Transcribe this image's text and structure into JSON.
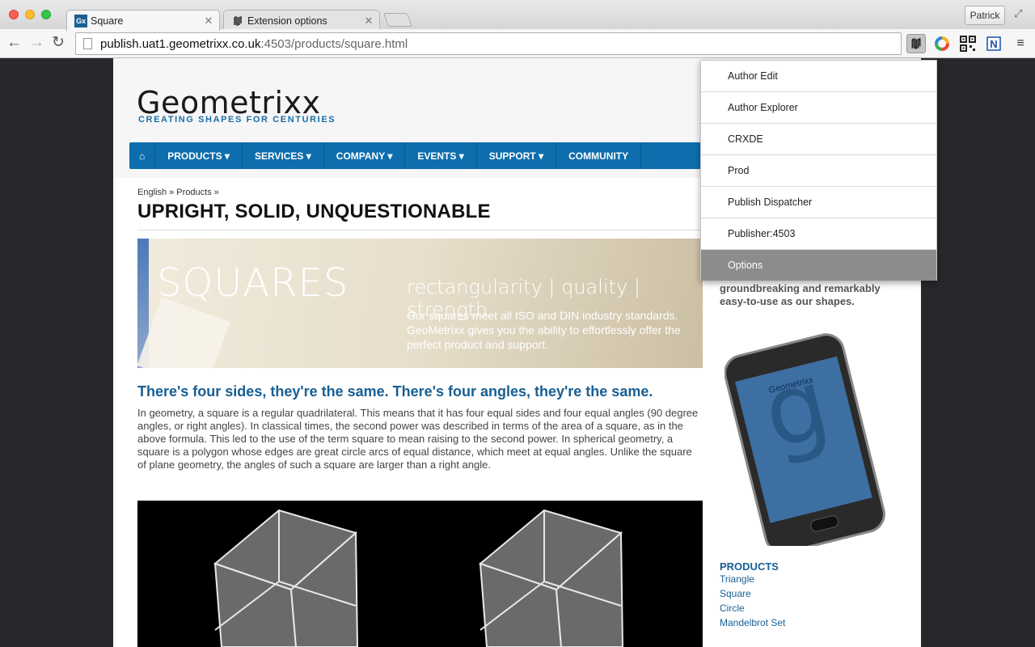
{
  "browser": {
    "tabs": [
      {
        "favicon": "Gx",
        "title": "Square",
        "active": true
      },
      {
        "favicon": "extension-icon",
        "title": "Extension options",
        "active": false
      }
    ],
    "profile": "Patrick",
    "address": {
      "host": "publish.uat1.geometrixx.co.uk",
      "rest": ":4503/products/square.html"
    }
  },
  "site": {
    "logo": "Geometrixx",
    "tagline": "CREATING SHAPES FOR CENTURIES",
    "nav": [
      "PRODUCTS ▾",
      "SERVICES ▾",
      "COMPANY ▾",
      "EVENTS ▾",
      "SUPPORT ▾",
      "COMMUNITY"
    ],
    "breadcrumb": "English » Products »",
    "heading": "UPRIGHT, SOLID, UNQUESTIONABLE",
    "banner": {
      "title": "SQUARES",
      "subtitle": "rectangularity | quality | strength",
      "body": "Our squares meet all ISO and DIN industry standards. GeoMetrixx gives you the ability to effortlessly offer the perfect product and support."
    },
    "subheading": "There's four sides, they're the same. There's four angles, they're the same.",
    "paragraph": "In geometry, a square is a regular quadrilateral. This means that it has four equal sides and four equal angles (90 degree angles, or right angles). In classical times, the second power was described in terms of the area of a square, as in the above formula. This led to the use of the term square to mean raising to the second power. In spherical geometry, a square is a polygon whose edges are great circle arcs of equal distance, which meet at equal angles. Unlike the square of plane geometry, the angles of such a square are larger than a right angle.",
    "sidebar": {
      "text": "groundbreaking and remarkably easy-to-use as our shapes.",
      "phone_brand": "Geometrixx",
      "products_heading": "PRODUCTS",
      "products": [
        "Triangle",
        "Square",
        "Circle",
        "Mandelbrot Set"
      ]
    }
  },
  "popup": {
    "items": [
      "Author Edit",
      "Author Explorer",
      "CRXDE",
      "Prod",
      "Publish Dispatcher",
      "Publisher:4503",
      "Options"
    ]
  }
}
